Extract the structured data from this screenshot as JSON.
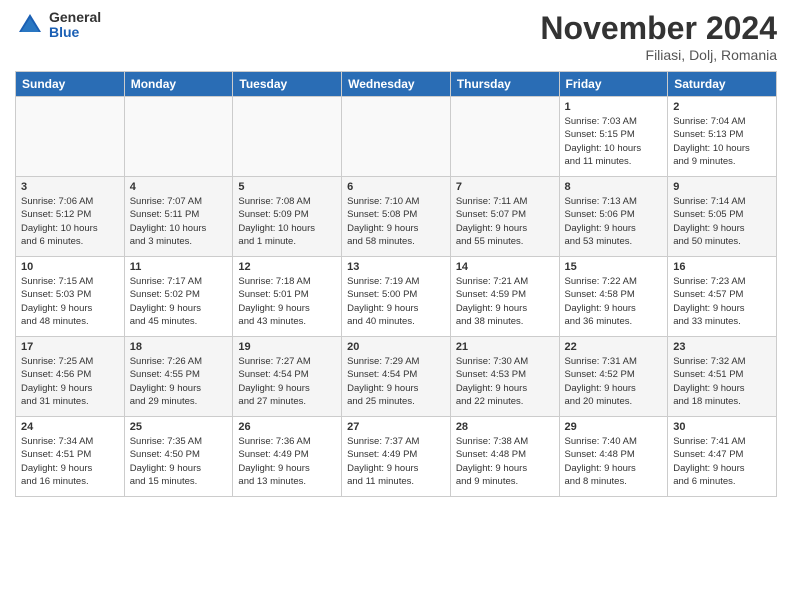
{
  "header": {
    "logo_general": "General",
    "logo_blue": "Blue",
    "month_title": "November 2024",
    "location": "Filiasi, Dolj, Romania"
  },
  "days_of_week": [
    "Sunday",
    "Monday",
    "Tuesday",
    "Wednesday",
    "Thursday",
    "Friday",
    "Saturday"
  ],
  "weeks": [
    [
      {
        "day": "",
        "info": ""
      },
      {
        "day": "",
        "info": ""
      },
      {
        "day": "",
        "info": ""
      },
      {
        "day": "",
        "info": ""
      },
      {
        "day": "",
        "info": ""
      },
      {
        "day": "1",
        "info": "Sunrise: 7:03 AM\nSunset: 5:15 PM\nDaylight: 10 hours\nand 11 minutes."
      },
      {
        "day": "2",
        "info": "Sunrise: 7:04 AM\nSunset: 5:13 PM\nDaylight: 10 hours\nand 9 minutes."
      }
    ],
    [
      {
        "day": "3",
        "info": "Sunrise: 7:06 AM\nSunset: 5:12 PM\nDaylight: 10 hours\nand 6 minutes."
      },
      {
        "day": "4",
        "info": "Sunrise: 7:07 AM\nSunset: 5:11 PM\nDaylight: 10 hours\nand 3 minutes."
      },
      {
        "day": "5",
        "info": "Sunrise: 7:08 AM\nSunset: 5:09 PM\nDaylight: 10 hours\nand 1 minute."
      },
      {
        "day": "6",
        "info": "Sunrise: 7:10 AM\nSunset: 5:08 PM\nDaylight: 9 hours\nand 58 minutes."
      },
      {
        "day": "7",
        "info": "Sunrise: 7:11 AM\nSunset: 5:07 PM\nDaylight: 9 hours\nand 55 minutes."
      },
      {
        "day": "8",
        "info": "Sunrise: 7:13 AM\nSunset: 5:06 PM\nDaylight: 9 hours\nand 53 minutes."
      },
      {
        "day": "9",
        "info": "Sunrise: 7:14 AM\nSunset: 5:05 PM\nDaylight: 9 hours\nand 50 minutes."
      }
    ],
    [
      {
        "day": "10",
        "info": "Sunrise: 7:15 AM\nSunset: 5:03 PM\nDaylight: 9 hours\nand 48 minutes."
      },
      {
        "day": "11",
        "info": "Sunrise: 7:17 AM\nSunset: 5:02 PM\nDaylight: 9 hours\nand 45 minutes."
      },
      {
        "day": "12",
        "info": "Sunrise: 7:18 AM\nSunset: 5:01 PM\nDaylight: 9 hours\nand 43 minutes."
      },
      {
        "day": "13",
        "info": "Sunrise: 7:19 AM\nSunset: 5:00 PM\nDaylight: 9 hours\nand 40 minutes."
      },
      {
        "day": "14",
        "info": "Sunrise: 7:21 AM\nSunset: 4:59 PM\nDaylight: 9 hours\nand 38 minutes."
      },
      {
        "day": "15",
        "info": "Sunrise: 7:22 AM\nSunset: 4:58 PM\nDaylight: 9 hours\nand 36 minutes."
      },
      {
        "day": "16",
        "info": "Sunrise: 7:23 AM\nSunset: 4:57 PM\nDaylight: 9 hours\nand 33 minutes."
      }
    ],
    [
      {
        "day": "17",
        "info": "Sunrise: 7:25 AM\nSunset: 4:56 PM\nDaylight: 9 hours\nand 31 minutes."
      },
      {
        "day": "18",
        "info": "Sunrise: 7:26 AM\nSunset: 4:55 PM\nDaylight: 9 hours\nand 29 minutes."
      },
      {
        "day": "19",
        "info": "Sunrise: 7:27 AM\nSunset: 4:54 PM\nDaylight: 9 hours\nand 27 minutes."
      },
      {
        "day": "20",
        "info": "Sunrise: 7:29 AM\nSunset: 4:54 PM\nDaylight: 9 hours\nand 25 minutes."
      },
      {
        "day": "21",
        "info": "Sunrise: 7:30 AM\nSunset: 4:53 PM\nDaylight: 9 hours\nand 22 minutes."
      },
      {
        "day": "22",
        "info": "Sunrise: 7:31 AM\nSunset: 4:52 PM\nDaylight: 9 hours\nand 20 minutes."
      },
      {
        "day": "23",
        "info": "Sunrise: 7:32 AM\nSunset: 4:51 PM\nDaylight: 9 hours\nand 18 minutes."
      }
    ],
    [
      {
        "day": "24",
        "info": "Sunrise: 7:34 AM\nSunset: 4:51 PM\nDaylight: 9 hours\nand 16 minutes."
      },
      {
        "day": "25",
        "info": "Sunrise: 7:35 AM\nSunset: 4:50 PM\nDaylight: 9 hours\nand 15 minutes."
      },
      {
        "day": "26",
        "info": "Sunrise: 7:36 AM\nSunset: 4:49 PM\nDaylight: 9 hours\nand 13 minutes."
      },
      {
        "day": "27",
        "info": "Sunrise: 7:37 AM\nSunset: 4:49 PM\nDaylight: 9 hours\nand 11 minutes."
      },
      {
        "day": "28",
        "info": "Sunrise: 7:38 AM\nSunset: 4:48 PM\nDaylight: 9 hours\nand 9 minutes."
      },
      {
        "day": "29",
        "info": "Sunrise: 7:40 AM\nSunset: 4:48 PM\nDaylight: 9 hours\nand 8 minutes."
      },
      {
        "day": "30",
        "info": "Sunrise: 7:41 AM\nSunset: 4:47 PM\nDaylight: 9 hours\nand 6 minutes."
      }
    ]
  ]
}
